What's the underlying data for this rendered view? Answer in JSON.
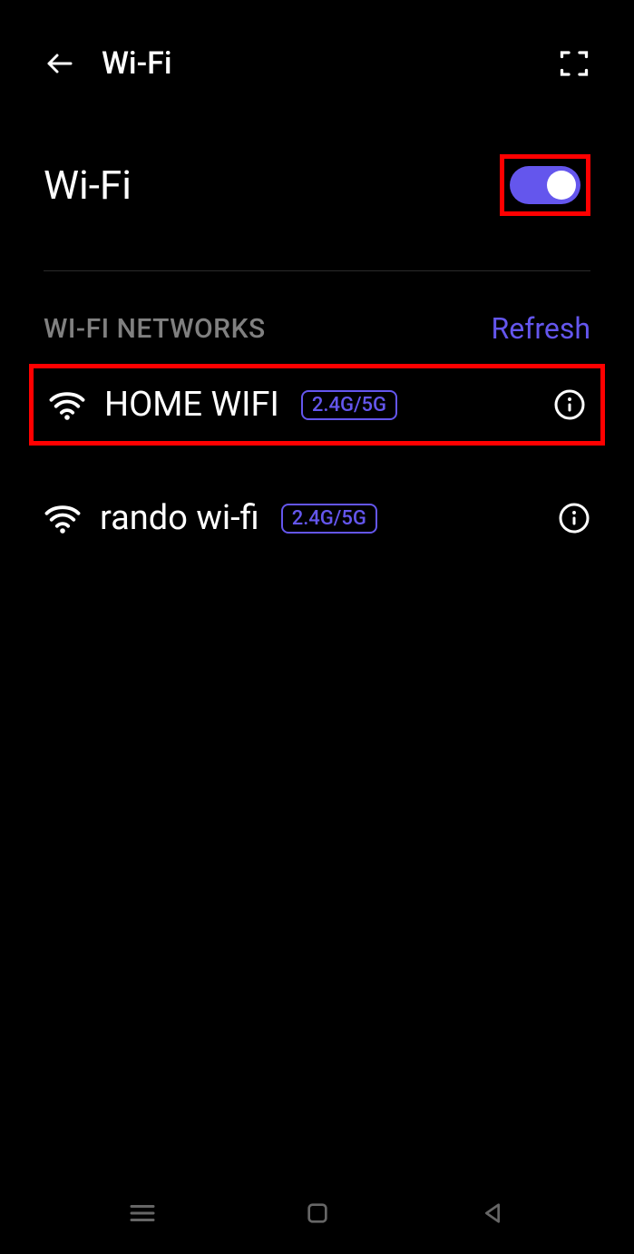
{
  "header": {
    "title": "Wi-Fi"
  },
  "wifi_toggle": {
    "label": "Wi-Fi",
    "enabled": true
  },
  "networks": {
    "header_label": "WI-FI NETWORKS",
    "refresh_label": "Refresh",
    "items": [
      {
        "name": "HOME WIFI",
        "band": "2.4G/5G",
        "highlighted": true
      },
      {
        "name": "rando wi-fi",
        "band": "2.4G/5G",
        "highlighted": false
      }
    ]
  },
  "colors": {
    "accent": "#6456ED",
    "highlight": "#ff0000"
  }
}
